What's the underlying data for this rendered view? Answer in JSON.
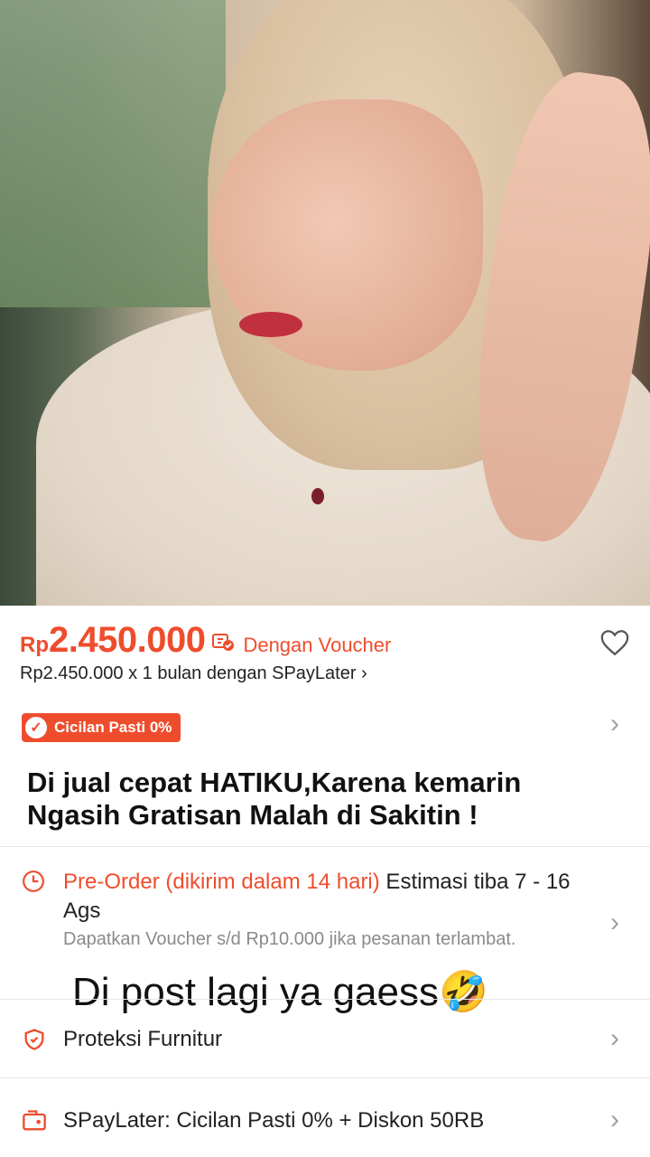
{
  "product": {
    "currency": "Rp",
    "price": "2.450.000",
    "voucher_label": "Dengan Voucher",
    "installment": "Rp2.450.000 x 1 bulan dengan SPayLater ›",
    "badge": "Cicilan Pasti 0%"
  },
  "overlay_caption": "Di jual cepat HATIKU,Karena kemarin Ngasih Gratisan Malah di Sakitin !",
  "shipping": {
    "preorder": "Pre-Order (dikirim dalam 14 hari)",
    "estimate": " Estimasi tiba 7 - 16 Ags",
    "voucher_note": "Dapatkan Voucher s/d Rp10.000 jika pesanan terlambat."
  },
  "overlay_caption_2": "Di post lagi ya gaess🤣",
  "rows": {
    "protection": "Proteksi Furnitur",
    "spaylater": "SPayLater: Cicilan Pasti 0% + Diskon 50RB"
  },
  "colors": {
    "accent": "#ee4d2d"
  },
  "icons": [
    "voucher-icon",
    "heart-icon",
    "check-icon",
    "chevron-right-icon",
    "clock-icon",
    "shield-icon",
    "spaylater-icon"
  ]
}
